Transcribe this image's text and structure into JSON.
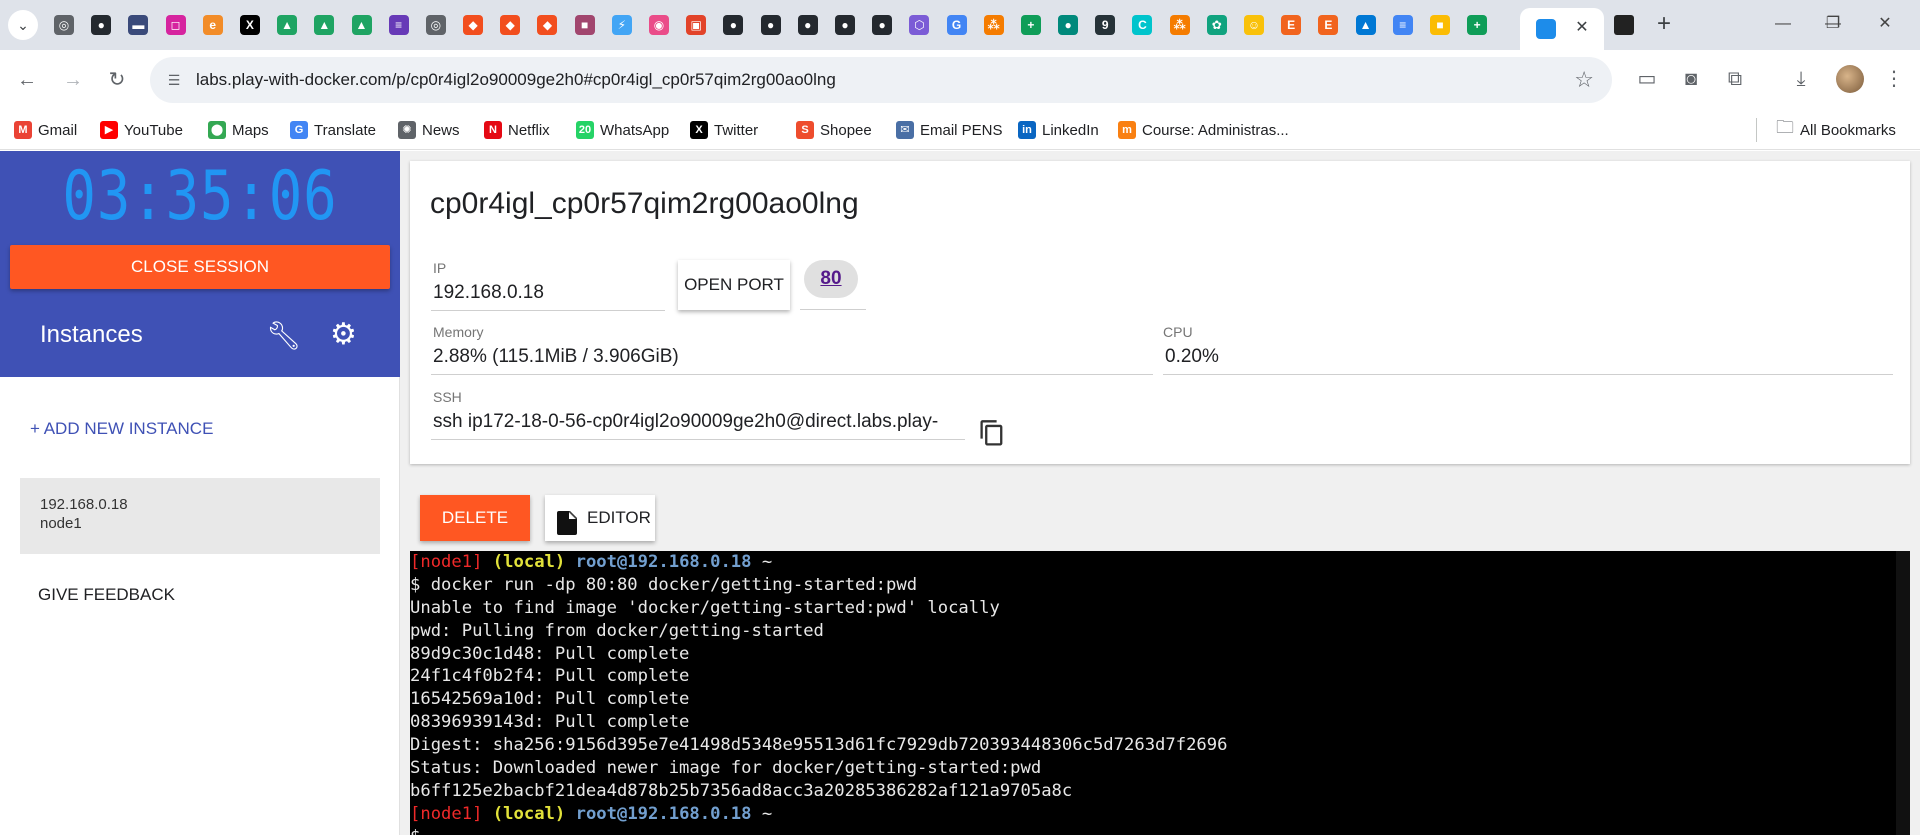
{
  "browser": {
    "tab_favicons": [
      {
        "name": "chrome-icon",
        "color": "#5f6368",
        "glyph": "◎"
      },
      {
        "name": "github-icon",
        "color": "#24292f",
        "glyph": "●"
      },
      {
        "name": "bar-icon",
        "color": "#3a4a7a",
        "glyph": "▬"
      },
      {
        "name": "instagram-icon",
        "color": "#d6249f",
        "glyph": "◻"
      },
      {
        "name": "e-icon",
        "color": "#f28c28",
        "glyph": "e"
      },
      {
        "name": "x-icon",
        "color": "#000000",
        "glyph": "X"
      },
      {
        "name": "drive-icon",
        "color": "#1fa463",
        "glyph": "▲"
      },
      {
        "name": "drive-icon",
        "color": "#1fa463",
        "glyph": "▲"
      },
      {
        "name": "drive-icon",
        "color": "#1fa463",
        "glyph": "▲"
      },
      {
        "name": "forms-icon",
        "color": "#673ab7",
        "glyph": "≡"
      },
      {
        "name": "globe-icon",
        "color": "#5f6368",
        "glyph": "◎"
      },
      {
        "name": "figma-icon",
        "color": "#f24e1e",
        "glyph": "◆"
      },
      {
        "name": "figma-icon",
        "color": "#f24e1e",
        "glyph": "◆"
      },
      {
        "name": "figma-icon",
        "color": "#f24e1e",
        "glyph": "◆"
      },
      {
        "name": "square-icon",
        "color": "#a1466e",
        "glyph": "■"
      },
      {
        "name": "flutter-icon",
        "color": "#42a5f5",
        "glyph": "⚡"
      },
      {
        "name": "dribbble-icon",
        "color": "#ea4c89",
        "glyph": "◉"
      },
      {
        "name": "gitlab-icon",
        "color": "#e24329",
        "glyph": "▣"
      },
      {
        "name": "github-icon",
        "color": "#24292f",
        "glyph": "●"
      },
      {
        "name": "github-icon",
        "color": "#24292f",
        "glyph": "●"
      },
      {
        "name": "github-icon",
        "color": "#24292f",
        "glyph": "●"
      },
      {
        "name": "github-icon",
        "color": "#24292f",
        "glyph": "●"
      },
      {
        "name": "github-icon",
        "color": "#24292f",
        "glyph": "●"
      },
      {
        "name": "cube-icon",
        "color": "#7b5cd6",
        "glyph": "⬡"
      },
      {
        "name": "google-icon",
        "color": "#4285f4",
        "glyph": "G"
      },
      {
        "name": "circles-icon",
        "color": "#f57c00",
        "glyph": "⁂"
      },
      {
        "name": "sheets-icon",
        "color": "#0f9d58",
        "glyph": "+"
      },
      {
        "name": "teal-icon",
        "color": "#00897b",
        "glyph": "●"
      },
      {
        "name": "nine-icon",
        "color": "#263238",
        "glyph": "9"
      },
      {
        "name": "canva-icon",
        "color": "#00c4cc",
        "glyph": "C"
      },
      {
        "name": "circles-icon",
        "color": "#f57c00",
        "glyph": "⁂"
      },
      {
        "name": "chatgpt-icon",
        "color": "#10a37f",
        "glyph": "✿"
      },
      {
        "name": "emoji-icon",
        "color": "#f9c10a",
        "glyph": "☺"
      },
      {
        "name": "etsy-icon",
        "color": "#f1641e",
        "glyph": "E"
      },
      {
        "name": "etsy-icon",
        "color": "#f1641e",
        "glyph": "E"
      },
      {
        "name": "azure-icon",
        "color": "#0078d4",
        "glyph": "▲"
      },
      {
        "name": "docs-icon",
        "color": "#4285f4",
        "glyph": "≡"
      },
      {
        "name": "keep-icon",
        "color": "#fbbc04",
        "glyph": "■"
      },
      {
        "name": "sheets-icon",
        "color": "#0f9d58",
        "glyph": "+"
      }
    ],
    "tab_close": "✕",
    "new_tab": "+",
    "url": "labs.play-with-docker.com/p/cp0r4igl2o90009ge2h0#cp0r4igl_cp0r57qim2rg00ao0lng",
    "bookmarks": [
      {
        "label": "Gmail",
        "icon": "gmail-icon",
        "color": "#ea4335",
        "glyph": "M"
      },
      {
        "label": "YouTube",
        "icon": "youtube-icon",
        "color": "#ff0000",
        "glyph": "▶"
      },
      {
        "label": "Maps",
        "icon": "maps-icon",
        "color": "#34a853",
        "glyph": "⬤"
      },
      {
        "label": "Translate",
        "icon": "translate-icon",
        "color": "#4285f4",
        "glyph": "G"
      },
      {
        "label": "News",
        "icon": "news-icon",
        "color": "#5f6368",
        "glyph": "✺"
      },
      {
        "label": "Netflix",
        "icon": "netflix-icon",
        "color": "#e50914",
        "glyph": "N"
      },
      {
        "label": "WhatsApp",
        "icon": "whatsapp-icon",
        "color": "#25d366",
        "glyph": "20"
      },
      {
        "label": "Twitter",
        "icon": "twitter-icon",
        "color": "#000000",
        "glyph": "X"
      },
      {
        "label": "Shopee",
        "icon": "shopee-icon",
        "color": "#ee4d2d",
        "glyph": "S"
      },
      {
        "label": "Email PENS",
        "icon": "email-icon",
        "color": "#4a6fa5",
        "glyph": "✉"
      },
      {
        "label": "LinkedIn",
        "icon": "linkedin-icon",
        "color": "#0a66c2",
        "glyph": "in"
      },
      {
        "label": "Course: Administras...",
        "icon": "moodle-icon",
        "color": "#f98012",
        "glyph": "m"
      }
    ],
    "all_bookmarks": "All Bookmarks"
  },
  "sidebar": {
    "timer": "03:35:06",
    "close_session": "CLOSE SESSION",
    "instances_title": "Instances",
    "add_instance": "+ ADD NEW INSTANCE",
    "instance": {
      "ip": "192.168.0.18",
      "name": "node1"
    },
    "feedback": "GIVE FEEDBACK"
  },
  "details": {
    "title": "cp0r4igl_cp0r57qim2rg00ao0lng",
    "ip_label": "IP",
    "ip_value": "192.168.0.18",
    "open_port": "OPEN PORT",
    "port": "80",
    "memory_label": "Memory",
    "memory_value": "2.88% (115.1MiB / 3.906GiB)",
    "cpu_label": "CPU",
    "cpu_value": "0.20%",
    "ssh_label": "SSH",
    "ssh_value": "ssh ip172-18-0-56-cp0r4igl2o90009ge2h0@direct.labs.play-",
    "delete": "DELETE",
    "editor": "EDITOR"
  },
  "terminal": {
    "prompt_node": "[node1]",
    "prompt_local": "(local)",
    "prompt_user": "root@192.168.0.18",
    "prompt_tilde": "~",
    "lines": [
      "$ docker run -dp 80:80 docker/getting-started:pwd",
      "Unable to find image 'docker/getting-started:pwd' locally",
      "pwd: Pulling from docker/getting-started",
      "89d9c30c1d48: Pull complete",
      "24f1c4f0b2f4: Pull complete",
      "16542569a10d: Pull complete",
      "08396939143d: Pull complete",
      "Digest: sha256:9156d395e7e41498d5348e95513d61fc7929db720393448306c5d7263d7f2696",
      "Status: Downloaded newer image for docker/getting-started:pwd",
      "b6ff125e2bacbf21dea4d878b25b7356ad8acc3a20285386282af121a9705a8c"
    ],
    "last_line_partial": "$ "
  }
}
